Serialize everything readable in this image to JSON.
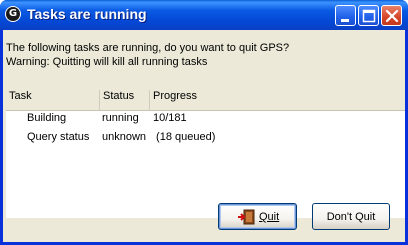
{
  "window": {
    "title": "Tasks are running",
    "app_icon_glyph": "G"
  },
  "message": {
    "line1": "The following tasks are running, do you want to quit GPS?",
    "line2": "Warning: Quitting will kill all running tasks"
  },
  "table": {
    "columns": [
      "Task",
      "Status",
      "Progress"
    ],
    "rows": [
      {
        "task": "Building",
        "status": "running",
        "progress": "10/181"
      },
      {
        "task": "Query status",
        "status": "unknown",
        "progress": " (18 queued)"
      }
    ]
  },
  "buttons": {
    "quit_label": "Quit",
    "dont_quit_label": "Don't Quit"
  },
  "icons": {
    "app": "gps-app-icon",
    "quit": "exit-door-icon",
    "minimize": "minimize-icon",
    "maximize": "maximize-icon",
    "close": "close-icon"
  },
  "colors": {
    "titlebar": "#0a5ae3",
    "client_bg": "#ece9d8",
    "list_bg": "#ffffff"
  }
}
